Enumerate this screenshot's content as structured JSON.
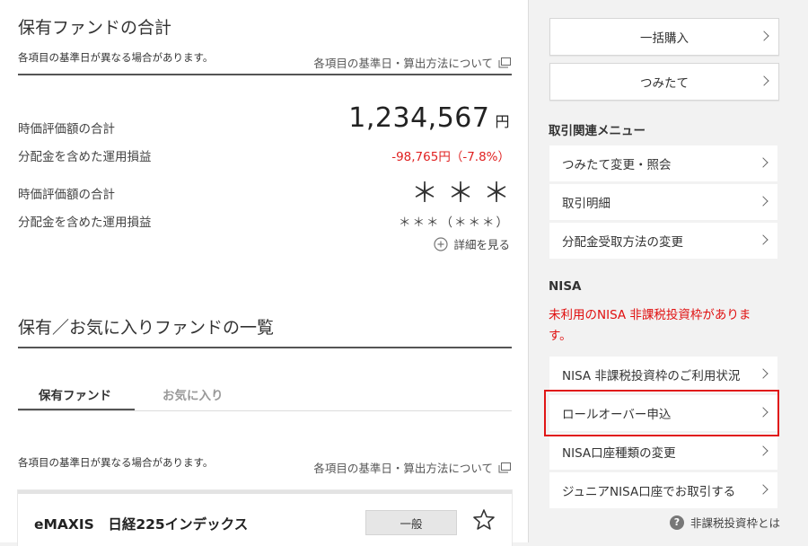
{
  "summary": {
    "title": "保有ファンドの合計",
    "note": "各項目の基準日が異なる場合があります。",
    "method_link": "各項目の基準日・算出方法について",
    "market_value_label": "時価評価額の合計",
    "market_value": "1,234,567",
    "market_value_unit": "円",
    "pnl_label": "分配金を含めた運用損益",
    "pnl_value": "-98,765円（-7.8%）",
    "masked_market_value_label": "時価評価額の合計",
    "masked_market_value": "＊＊＊",
    "masked_pnl_label": "分配金を含めた運用損益",
    "masked_pnl_value": "＊＊＊（＊＊＊）",
    "details_link": "詳細を見る"
  },
  "fund_list": {
    "title": "保有／お気に入りファンドの一覧",
    "tabs": [
      {
        "label": "保有ファンド",
        "active": true
      },
      {
        "label": "お気に入り",
        "active": false
      }
    ],
    "note": "各項目の基準日が異なる場合があります。",
    "method_link": "各項目の基準日・算出方法について",
    "fund": {
      "name": "eMAXIS　日経225インデックス",
      "badge": "一般"
    }
  },
  "sidebar": {
    "buttons": [
      {
        "label": "一括購入"
      },
      {
        "label": "つみたて"
      }
    ],
    "trade_menu_title": "取引関連メニュー",
    "trade_menu": [
      {
        "label": "つみたて変更・照会"
      },
      {
        "label": "取引明細"
      },
      {
        "label": "分配金受取方法の変更"
      }
    ],
    "nisa_title": "NISA",
    "nisa_warning": "未利用のNISA 非課税投資枠がありま す。",
    "nisa_menu": [
      {
        "label": "NISA 非課税投資枠のご利用状況"
      },
      {
        "label": "ロールオーバー申込"
      },
      {
        "label": "NISA口座種類の変更"
      },
      {
        "label": "ジュニアNISA口座でお取引する"
      }
    ],
    "help_link": "非課税投資枠とは"
  },
  "colors": {
    "negative": "#e02020",
    "highlight_border": "#e01515",
    "warning_text": "#e01010"
  }
}
